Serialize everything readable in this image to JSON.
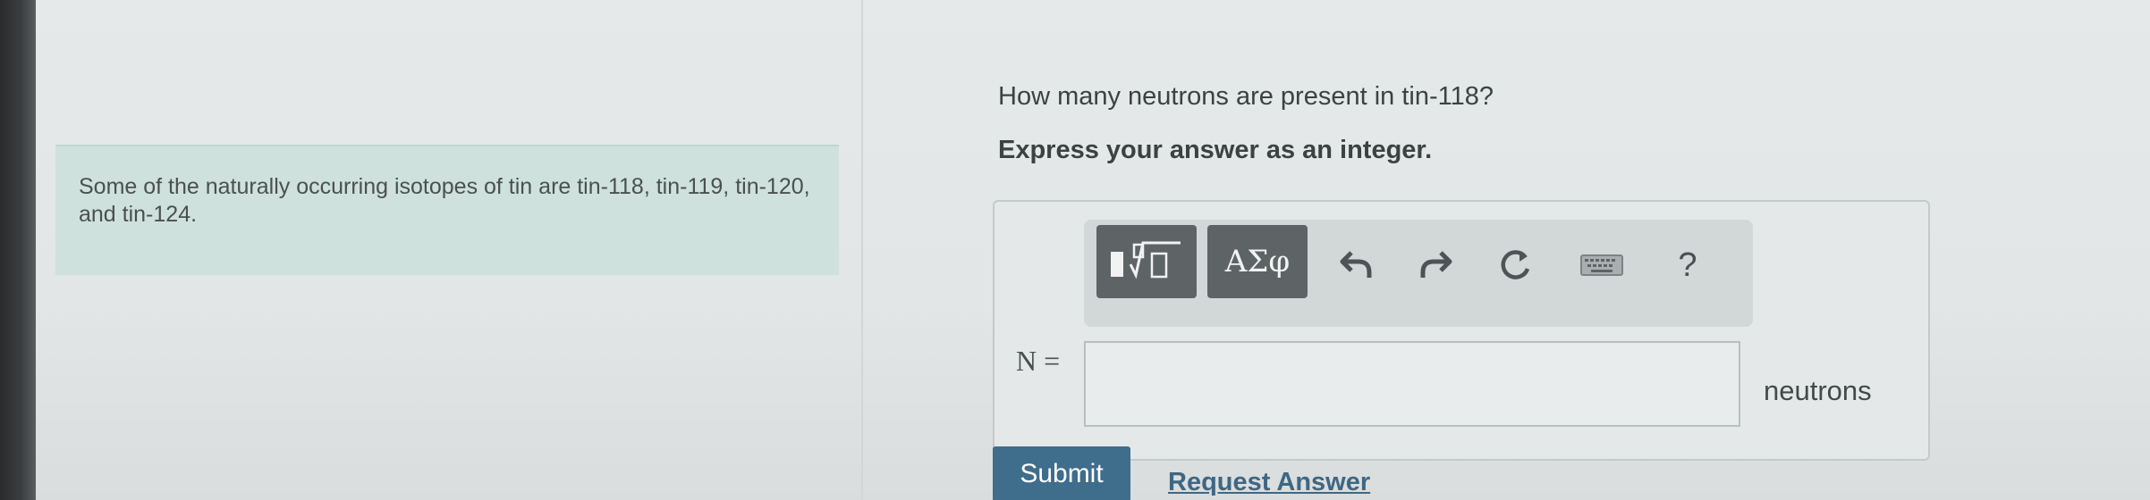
{
  "context": {
    "text": "Some of the naturally occurring isotopes of tin are tin-118, tin-119, tin-120, and tin-124."
  },
  "question": {
    "prompt": "How many neutrons are present in tin-118?",
    "instruction": "Express your answer as an integer."
  },
  "toolbar": {
    "symbols_label": "ΑΣφ",
    "help_label": "?",
    "icons": [
      "templates-icon",
      "greek-symbols-icon",
      "undo-icon",
      "redo-icon",
      "reset-icon",
      "keyboard-icon",
      "help-icon"
    ]
  },
  "answer": {
    "variable": "N =",
    "value": "",
    "unit": "neutrons"
  },
  "actions": {
    "submit_label": "Submit",
    "request_label": "Request Answer"
  },
  "colors": {
    "context_panel": "#cfe1dd",
    "submit_button": "#3f6d8c",
    "link": "#3e6784",
    "toolbar_button": "#5e6466"
  }
}
